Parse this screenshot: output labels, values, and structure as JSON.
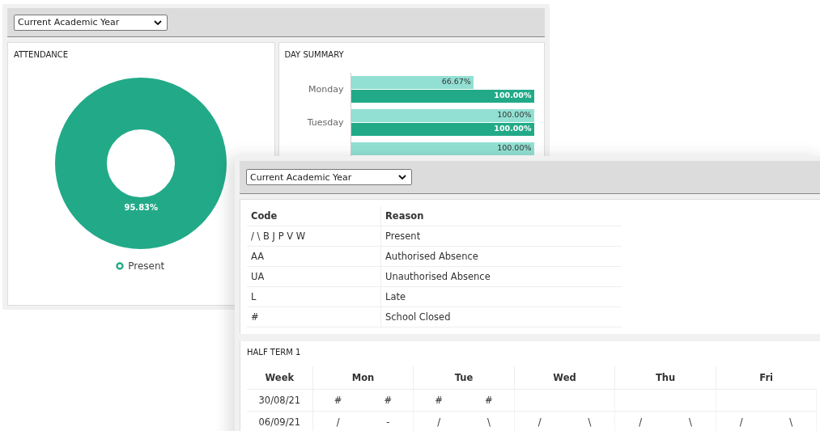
{
  "back_window": {
    "year_select": {
      "value": "Current Academic Year"
    },
    "attendance": {
      "title": "ATTENDANCE",
      "donut_label": "95.83%",
      "legend": [
        {
          "label": "Present",
          "color": "#22aa88"
        }
      ]
    },
    "day_summary": {
      "title": "DAY SUMMARY",
      "days": [
        {
          "day": "Monday",
          "bars": [
            {
              "kind": "light",
              "level": 0.67,
              "reading": "66.67%"
            },
            {
              "kind": "dark",
              "level": 1,
              "reading": "100.00%"
            }
          ]
        },
        {
          "day": "Tuesday",
          "bars": [
            {
              "kind": "light",
              "level": 1,
              "reading": "100.00%"
            },
            {
              "kind": "dark",
              "level": 1,
              "reading": "100.00%"
            }
          ]
        },
        {
          "bars": [
            {
              "kind": "light",
              "level": 1,
              "reading": "100.00%"
            }
          ]
        }
      ]
    }
  },
  "front_window": {
    "year_select": {
      "value": "Current Academic Year"
    },
    "codes_table": {
      "columns": [
        "Code",
        "Reason"
      ],
      "rows": [
        [
          "/ \\ B J P V W",
          "Present"
        ],
        [
          "AA",
          "Authorised Absence"
        ],
        [
          "UA",
          "Unauthorised Absence"
        ],
        [
          "L",
          "Late"
        ],
        [
          "#",
          "School Closed"
        ]
      ]
    },
    "half_term": {
      "title": "HALF TERM 1",
      "columns": [
        "Week",
        "Mon",
        "Tue",
        "Wed",
        "Thu",
        "Fri"
      ],
      "rows": [
        {
          "week": "30/08/21",
          "days": [
            {
              "am": "#",
              "pm": "#"
            },
            {
              "am": "#",
              "pm": "#"
            }
          ]
        },
        {
          "week": "06/09/21",
          "days": [
            {
              "am": "/",
              "pm": "-"
            },
            {
              "am": "/",
              "pm": "\\"
            },
            {
              "am": "/",
              "pm": "\\"
            },
            {
              "am": "/",
              "pm": "\\"
            },
            {
              "am": "/",
              "pm": "\\"
            }
          ]
        }
      ]
    }
  }
}
